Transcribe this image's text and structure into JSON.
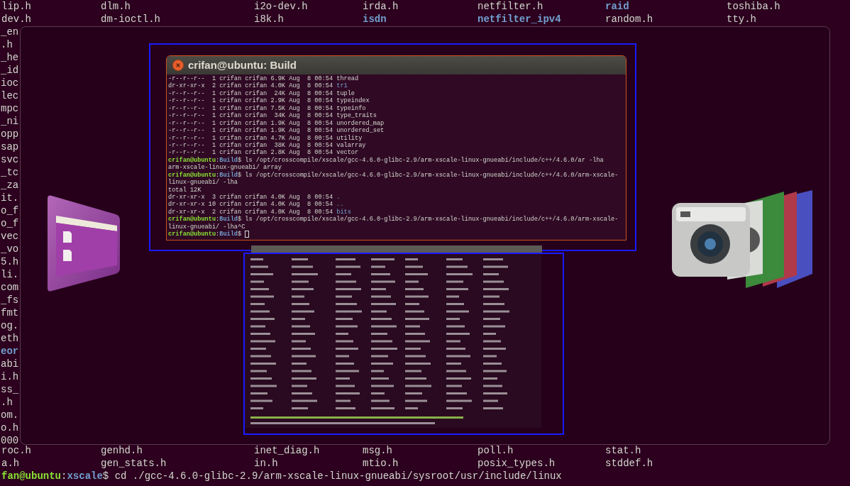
{
  "background_terminal": {
    "top_rows": [
      [
        {
          "name": "lip.h",
          "dir": false
        },
        {
          "name": "dlm.h",
          "dir": false
        },
        {
          "name": "i2o-dev.h",
          "dir": false
        },
        {
          "name": "irda.h",
          "dir": false
        },
        {
          "name": "netfilter.h",
          "dir": false
        },
        {
          "name": "raid",
          "dir": true
        },
        {
          "name": "toshiba.h",
          "dir": false
        }
      ],
      [
        {
          "name": "dev.h",
          "dir": false
        },
        {
          "name": "dm-ioctl.h",
          "dir": false
        },
        {
          "name": "i8k.h",
          "dir": false
        },
        {
          "name": "isdn",
          "dir": true
        },
        {
          "name": "netfilter_ipv4",
          "dir": true
        },
        {
          "name": "random.h",
          "dir": false
        },
        {
          "name": "tty.h",
          "dir": false
        }
      ]
    ],
    "left_fragments": [
      {
        "text": "_en",
        "dir": false
      },
      {
        "text": ".h",
        "dir": false
      },
      {
        "text": "_he",
        "dir": false
      },
      {
        "text": "_id",
        "dir": false
      },
      {
        "text": "ioc",
        "dir": false
      },
      {
        "text": "lec",
        "dir": false
      },
      {
        "text": "mpc",
        "dir": false
      },
      {
        "text": "_ni",
        "dir": false
      },
      {
        "text": "opp",
        "dir": false
      },
      {
        "text": "sap",
        "dir": false
      },
      {
        "text": "svc",
        "dir": false
      },
      {
        "text": "_tc",
        "dir": false
      },
      {
        "text": "_za",
        "dir": false
      },
      {
        "text": "it.",
        "dir": false
      },
      {
        "text": "o_f",
        "dir": false
      },
      {
        "text": "o_f",
        "dir": false
      },
      {
        "text": "vec",
        "dir": false
      },
      {
        "text": "_vo",
        "dir": false
      },
      {
        "text": "5.h",
        "dir": false
      },
      {
        "text": "li.",
        "dir": false
      },
      {
        "text": "com",
        "dir": false
      },
      {
        "text": "_fs",
        "dir": false
      },
      {
        "text": "fmt",
        "dir": false
      },
      {
        "text": "og.",
        "dir": false
      },
      {
        "text": "eth",
        "dir": false
      },
      {
        "text": "eor",
        "dir": true
      },
      {
        "text": "abi",
        "dir": false
      },
      {
        "text": "i.h",
        "dir": false
      },
      {
        "text": "ss_",
        "dir": false
      },
      {
        "text": ".h",
        "dir": false
      },
      {
        "text": "om.",
        "dir": false
      },
      {
        "text": "o.h",
        "dir": false
      },
      {
        "text": "000",
        "dir": false
      }
    ],
    "bottom_rows": [
      [
        {
          "name": "roc.h",
          "dir": false
        },
        {
          "name": "genhd.h",
          "dir": false
        },
        {
          "name": "inet_diag.h",
          "dir": false
        },
        {
          "name": "msg.h",
          "dir": false
        },
        {
          "name": "poll.h",
          "dir": false
        },
        {
          "name": "stat.h",
          "dir": false
        }
      ],
      [
        {
          "name": "a.h",
          "dir": false
        },
        {
          "name": "gen_stats.h",
          "dir": false
        },
        {
          "name": "in.h",
          "dir": false
        },
        {
          "name": "mtio.h",
          "dir": false
        },
        {
          "name": "posix_types.h",
          "dir": false
        },
        {
          "name": "stddef.h",
          "dir": false
        }
      ]
    ],
    "prompt": {
      "login": "fan@ubuntu",
      "separator": ":",
      "dir": "xscale",
      "symbol": "$",
      "command": "cd ./gcc-4.6.0-glibc-2.9/arm-xscale-linux-gnueabi/sysroot/usr/include/linux"
    }
  },
  "switcher": {
    "window": {
      "title": "crifan@ubuntu: Build",
      "lines": [
        {
          "kind": "entry",
          "info": "-r--r--r--  1 crifan crifan 6.9K Aug  8 00:54",
          "name": "thread",
          "dir": false
        },
        {
          "kind": "entry",
          "info": "dr-xr-xr-x  2 crifan crifan 4.0K Aug  8 00:54",
          "name": "tr1",
          "dir": true
        },
        {
          "kind": "entry",
          "info": "-r--r--r--  1 crifan crifan  24K Aug  8 00:54",
          "name": "tuple",
          "dir": false
        },
        {
          "kind": "entry",
          "info": "-r--r--r--  1 crifan crifan 2.9K Aug  8 00:54",
          "name": "typeindex",
          "dir": false
        },
        {
          "kind": "entry",
          "info": "-r--r--r--  1 crifan crifan 7.5K Aug  8 00:54",
          "name": "typeinfo",
          "dir": false
        },
        {
          "kind": "entry",
          "info": "-r--r--r--  1 crifan crifan  34K Aug  8 00:54",
          "name": "type_traits",
          "dir": false
        },
        {
          "kind": "entry",
          "info": "-r--r--r--  1 crifan crifan 1.9K Aug  8 00:54",
          "name": "unordered_map",
          "dir": false
        },
        {
          "kind": "entry",
          "info": "-r--r--r--  1 crifan crifan 1.9K Aug  8 00:54",
          "name": "unordered_set",
          "dir": false
        },
        {
          "kind": "entry",
          "info": "-r--r--r--  1 crifan crifan 4.7K Aug  8 00:54",
          "name": "utility",
          "dir": false
        },
        {
          "kind": "entry",
          "info": "-r--r--r--  1 crifan crifan  38K Aug  8 00:54",
          "name": "valarray",
          "dir": false
        },
        {
          "kind": "entry",
          "info": "-r--r--r--  1 crifan crifan 2.8K Aug  8 00:54",
          "name": "vector",
          "dir": false
        },
        {
          "kind": "prompt",
          "login": "crifan@ubuntu",
          "separator": ":",
          "dir": "Build",
          "symbol": "$",
          "command": "ls /opt/crosscompile/xscale/gcc-4.6.0-glibc-2.9/arm-xscale-linux-gnueabi/include/c++/4.6.0/ar -lha"
        },
        {
          "kind": "text",
          "text": "arm-xscale-linux-gnueabi/ array"
        },
        {
          "kind": "prompt",
          "login": "crifan@ubuntu",
          "separator": ":",
          "dir": "Build",
          "symbol": "$",
          "command": "ls /opt/crosscompile/xscale/gcc-4.6.0-glibc-2.9/arm-xscale-linux-gnueabi/include/c++/4.6.0/arm-xscale-"
        },
        {
          "kind": "text",
          "text": "linux-gnueabi/ -lha"
        },
        {
          "kind": "text",
          "text": "total 12K"
        },
        {
          "kind": "entry",
          "info": "dr-xr-xr-x  3 crifan crifan 4.0K Aug  8 00:54",
          "name": ".",
          "dir": true
        },
        {
          "kind": "entry",
          "info": "dr-xr-xr-x 10 crifan crifan 4.0K Aug  8 00:54",
          "name": "..",
          "dir": true
        },
        {
          "kind": "entry",
          "info": "dr-xr-xr-x  2 crifan crifan 4.0K Aug  8 00:54",
          "name": "bits",
          "dir": true
        },
        {
          "kind": "prompt",
          "login": "crifan@ubuntu",
          "separator": ":",
          "dir": "Build",
          "symbol": "$",
          "command": "ls /opt/crosscompile/xscale/gcc-4.6.0-glibc-2.9/arm-xscale-linux-gnueabi/include/c++/4.6.0/arm-xscale-"
        },
        {
          "kind": "text",
          "text": "linux-gnueabi/ -lha^C"
        },
        {
          "kind": "prompt",
          "login": "crifan@ubuntu",
          "separator": ":",
          "dir": "Build",
          "symbol": "$",
          "cursor": true
        }
      ]
    }
  }
}
